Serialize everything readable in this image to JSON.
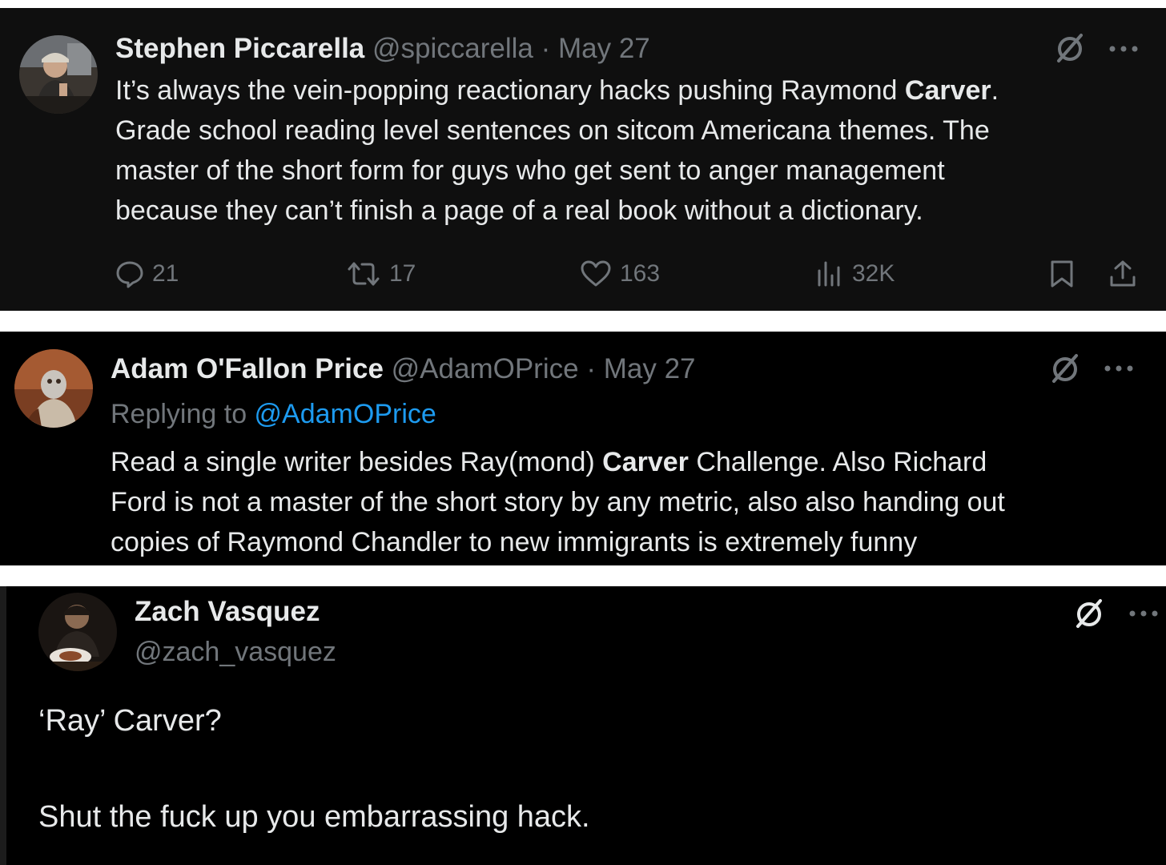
{
  "tweet1": {
    "name": "Stephen Piccarella",
    "handle": "@spiccarella",
    "separator": "·",
    "date": "May 27",
    "lines": [
      {
        "pre": "It’s always the vein-popping reactionary hacks pushing Raymond ",
        "bold": "Carver",
        "post": "."
      },
      {
        "pre": "Grade school reading level sentences on sitcom Americana themes. The",
        "bold": "",
        "post": ""
      },
      {
        "pre": "master of the short form for guys who get sent to anger management",
        "bold": "",
        "post": ""
      },
      {
        "pre": "because they can’t finish a page of a real book without a dictionary.",
        "bold": "",
        "post": ""
      }
    ],
    "actions": {
      "replies": "21",
      "reposts": "17",
      "likes": "163",
      "views": "32K"
    }
  },
  "tweet2": {
    "name": "Adam O'Fallon Price",
    "handle": "@AdamOPrice",
    "separator": "·",
    "date": "May 27",
    "replying_prefix": "Replying to ",
    "replying_handle": "@AdamOPrice",
    "lines": [
      {
        "pre": "Read a single writer besides Ray(mond) ",
        "bold": "Carver",
        "post": " Challenge. Also Richard"
      },
      {
        "pre": "Ford is not a master of the short story by any metric, also also handing out",
        "bold": "",
        "post": ""
      },
      {
        "pre": "copies of Raymond Chandler to new immigrants is extremely funny",
        "bold": "",
        "post": ""
      }
    ]
  },
  "tweet3": {
    "name": "Zach Vasquez",
    "handle": "@zach_vasquez",
    "line1": "‘Ray’ Carver?",
    "line2": "Shut the fuck up you embarrassing hack."
  },
  "icons": {
    "grok": "grok-icon",
    "more": "more-icon",
    "reply": "reply-icon",
    "repost": "repost-icon",
    "like": "heart-icon",
    "views": "views-icon",
    "bookmark": "bookmark-icon",
    "share": "share-icon"
  },
  "colors": {
    "text": "#e7e9ea",
    "muted": "#71767b",
    "link": "#1d9bf0",
    "background": "#000000"
  }
}
